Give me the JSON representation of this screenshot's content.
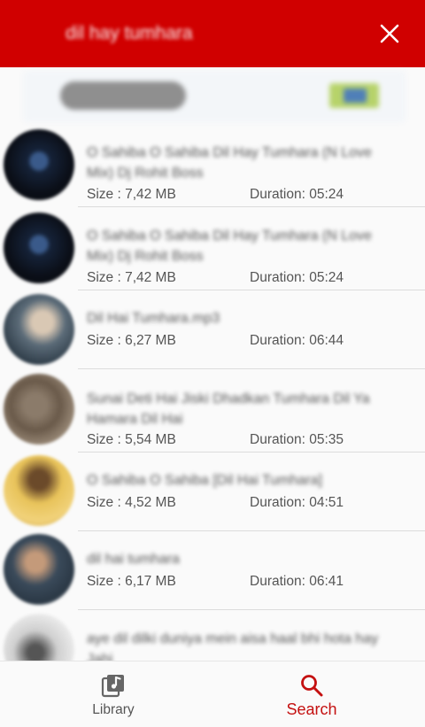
{
  "header": {
    "title": "dil hay tumhara",
    "close_icon": "close-icon",
    "background": "#d00000"
  },
  "results": [
    {
      "title": "O Sahiba O Sahiba Dil Hay Tumhara (N Love Mix) Dj Rohit Boss",
      "size": "Size : 7,42 MB",
      "duration": "Duration: 05:24"
    },
    {
      "title": "O Sahiba O Sahiba Dil Hay Tumhara (N Love Mix) Dj Rohit Boss",
      "size": "Size : 7,42 MB",
      "duration": "Duration: 05:24"
    },
    {
      "title": "Dil Hai Tumhara.mp3",
      "size": "Size : 6,27 MB",
      "duration": "Duration: 06:44"
    },
    {
      "title": "Sunai Deti Hai Jiski Dhadkan Tumhara Dil Ya Hamara Dil Hai",
      "size": "Size : 5,54 MB",
      "duration": "Duration: 05:35"
    },
    {
      "title": "O Sahiba O Sahiba [Dil Hai Tumhara]",
      "size": "Size : 4,52 MB",
      "duration": "Duration: 04:51"
    },
    {
      "title": "dil hai tumhara",
      "size": "Size : 6,17 MB",
      "duration": "Duration: 06:41"
    },
    {
      "title": "aye dil dilki duniya mein aisa haal bhi hota hay Jahi",
      "size": "",
      "duration": ""
    }
  ],
  "bottom_nav": {
    "library_label": "Library",
    "search_label": "Search",
    "active_color": "#c41010"
  }
}
